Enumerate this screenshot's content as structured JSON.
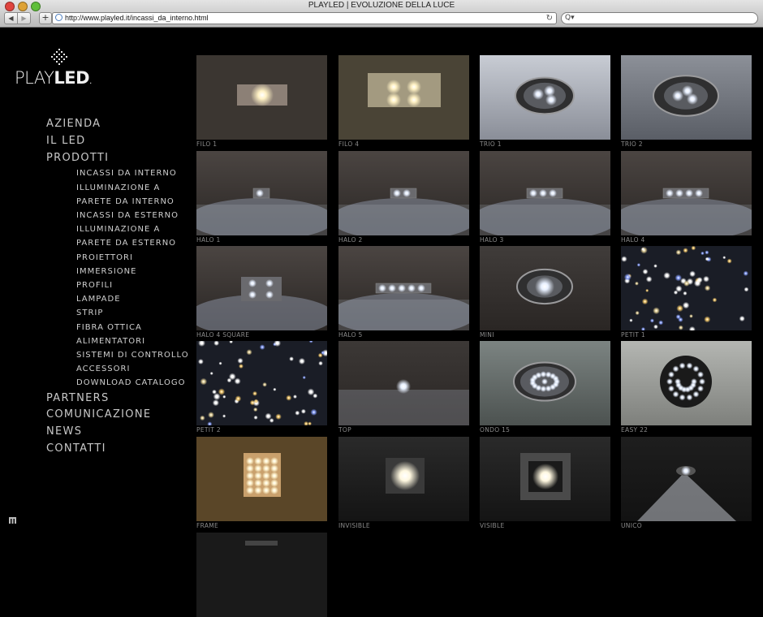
{
  "browser": {
    "title": "PLAYLED | EVOLUZIONE DELLA LUCE",
    "url": "http://www.playled.it/incassi_da_interno.html",
    "back_glyph": "◀",
    "forward_glyph": "▶",
    "add_glyph": "+",
    "reload_glyph": "↻",
    "search_glyph": "Q▾"
  },
  "logo": {
    "text_light": "PLAY",
    "text_bold": "LED",
    "mark": "."
  },
  "menu": {
    "items": [
      {
        "label": "AZIENDA"
      },
      {
        "label": "IL LED"
      },
      {
        "label": "PRODOTTI"
      }
    ],
    "subitems": [
      {
        "label": "INCASSI DA INTERNO"
      },
      {
        "label": "ILLUMINAZIONE A"
      },
      {
        "label": "PARETE DA INTERNO"
      },
      {
        "label": "INCASSI DA ESTERNO"
      },
      {
        "label": "ILLUMINAZIONE A"
      },
      {
        "label": "PARETE DA ESTERNO"
      },
      {
        "label": "PROIETTORI"
      },
      {
        "label": "IMMERSIONE"
      },
      {
        "label": "PROFILI"
      },
      {
        "label": "LAMPADE"
      },
      {
        "label": "STRIP"
      },
      {
        "label": "FIBRA OTTICA"
      },
      {
        "label": "ALIMENTATORI"
      },
      {
        "label": "SISTEMI DI CONTROLLO"
      },
      {
        "label": "ACCESSORI"
      },
      {
        "label": "DOWNLOAD CATALOGO"
      }
    ],
    "more": [
      {
        "label": "PARTNERS"
      },
      {
        "label": "COMUNICAZIONE"
      },
      {
        "label": "NEWS"
      },
      {
        "label": "CONTATTI"
      }
    ]
  },
  "products": [
    {
      "name": "FILO 1",
      "kind": "panel1"
    },
    {
      "name": "FILO 4",
      "kind": "panel4"
    },
    {
      "name": "TRIO 1",
      "kind": "trio"
    },
    {
      "name": "TRIO 2",
      "kind": "trio2"
    },
    {
      "name": "HALO 1",
      "kind": "halo1"
    },
    {
      "name": "HALO 2",
      "kind": "halo2"
    },
    {
      "name": "HALO 3",
      "kind": "halo3"
    },
    {
      "name": "HALO 4",
      "kind": "halo4"
    },
    {
      "name": "HALO 4 SQUARE",
      "kind": "halosq"
    },
    {
      "name": "HALO 5",
      "kind": "halo5"
    },
    {
      "name": "MINI",
      "kind": "mini"
    },
    {
      "name": "PETIT 1",
      "kind": "stars"
    },
    {
      "name": "PETIT 2",
      "kind": "stars2"
    },
    {
      "name": "TOP",
      "kind": "top"
    },
    {
      "name": "ONDO 15",
      "kind": "ondo"
    },
    {
      "name": "EASY 22",
      "kind": "easy"
    },
    {
      "name": "FRAME",
      "kind": "frame"
    },
    {
      "name": "INVISIBLE",
      "kind": "invisible"
    },
    {
      "name": "VISIBLE",
      "kind": "visible"
    },
    {
      "name": "UNICO",
      "kind": "unico"
    },
    {
      "name": "",
      "kind": "partial"
    }
  ]
}
